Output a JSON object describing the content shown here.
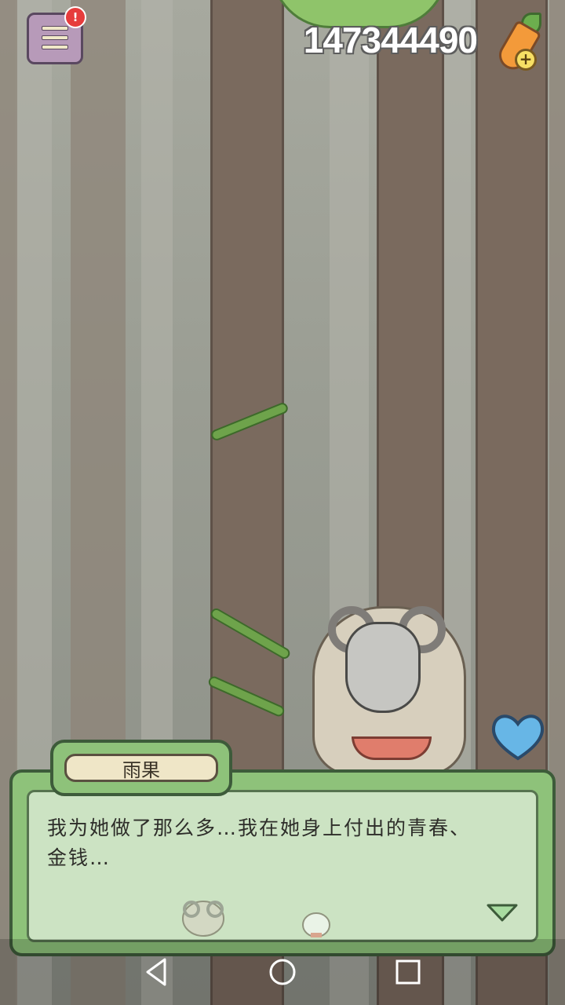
{
  "hud": {
    "coin_count": "147344490",
    "menu_badge": "!"
  },
  "dialog": {
    "speaker_name": "雨果",
    "line_1": "我为她做了那么多…我在她身上付出的青春、",
    "line_2": "金钱…"
  },
  "colors": {
    "dialog_frame": "#8ec27a",
    "heart": "#67b6e6",
    "badge": "#e63c3c"
  },
  "icons": [
    "menu-icon",
    "carrot-icon",
    "heart-icon",
    "next-arrow-icon",
    "back-icon",
    "home-icon",
    "recents-icon"
  ]
}
